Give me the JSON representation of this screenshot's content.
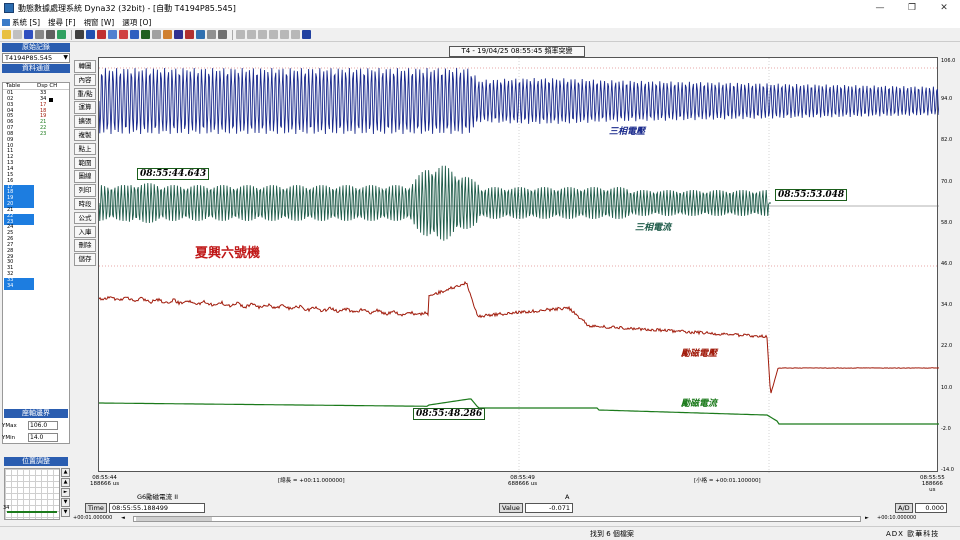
{
  "window": {
    "title": "動態數據處理系統 Dyna32 (32bit) - [自動 T4194P85.545]",
    "controls": [
      "—",
      "❐",
      "✕"
    ]
  },
  "menu": [
    {
      "label": "系統 [S]"
    },
    {
      "label": "搜尋 [F]"
    },
    {
      "label": "視窗 [W]"
    },
    {
      "label": "選項 [O]"
    }
  ],
  "left": {
    "record_header": "原始記錄",
    "file_name": "T4194P85.545",
    "channel_header": "資料通道",
    "col_table": "Table",
    "col_dsp": "Dsp CH",
    "tables": [
      "01",
      "02",
      "03",
      "04",
      "05",
      "06",
      "07",
      "08",
      "09",
      "10",
      "11",
      "12",
      "13",
      "14",
      "15",
      "16",
      "17",
      "18",
      "19",
      "20",
      "21",
      "22",
      "23",
      "24",
      "25",
      "26",
      "27",
      "28",
      "29",
      "30",
      "31",
      "32",
      "33",
      "34"
    ],
    "dsp_channels": [
      "33",
      "34",
      "17",
      "18",
      "19",
      "21",
      "22",
      "23"
    ],
    "axis_header": "座軸邊界",
    "ymax_label": "YMax",
    "ymin_label": "YMin",
    "ymax_value": "106.0",
    "ymin_value": "14.0",
    "pos_header": "位置調整"
  },
  "vbuttons": [
    "轉圖",
    "內容",
    "重/點",
    "運算",
    "擴張",
    "複製",
    "點上",
    "範圍",
    "圖線",
    "列印",
    "時段",
    "公式",
    "入庫",
    "刪除",
    "儲存"
  ],
  "plot": {
    "header": "T4 - 19/04/25 08:55:45  頻率突變",
    "legend_voltage": "三相電壓",
    "legend_current": "三相電流",
    "legend_exc_v": "勵磁電壓",
    "legend_exc_i": "勵磁電流",
    "station": "夏興六號機",
    "time_start": "08:55:44.643",
    "time_end": "08:55:53.048",
    "time_mid": "08:55:48.286",
    "y_ticks": [
      "106.0",
      "94.0",
      "82.0",
      "70.0",
      "58.0",
      "46.0",
      "34.0",
      "22.0",
      "10.0",
      "-2.0",
      "-14.0"
    ]
  },
  "time_axis": {
    "left_time": "08:55:44",
    "left_sub": "188666 us",
    "total": "[總長 = +00:11.000000]",
    "mid_time": "08:55:49",
    "mid_sub": "688666 us",
    "grid": "[小格 = +00:01.100000]",
    "right_time": "08:55:55",
    "right_sub": "188666 us"
  },
  "status": {
    "channel_name": "G6勵磁電流 II",
    "time_label": "Time",
    "time_value": "08:55:55.188499",
    "unit": "A",
    "value_label": "Value",
    "value_value": "-0.071",
    "ad_label": "A/D",
    "ad_value": "0.000",
    "scroll_left": "+00:01.000000",
    "scroll_right": "+00:10.000000",
    "left_small": "34"
  },
  "statusbar": {
    "found": "找到 6 個檔案",
    "company": "ADX 歐華科技"
  },
  "colors": {
    "voltage": "#1a2a8c",
    "current": "#1f5c4a",
    "exc_voltage": "#a01a0a",
    "exc_current": "#1b7a1b",
    "station": "#c01818"
  }
}
